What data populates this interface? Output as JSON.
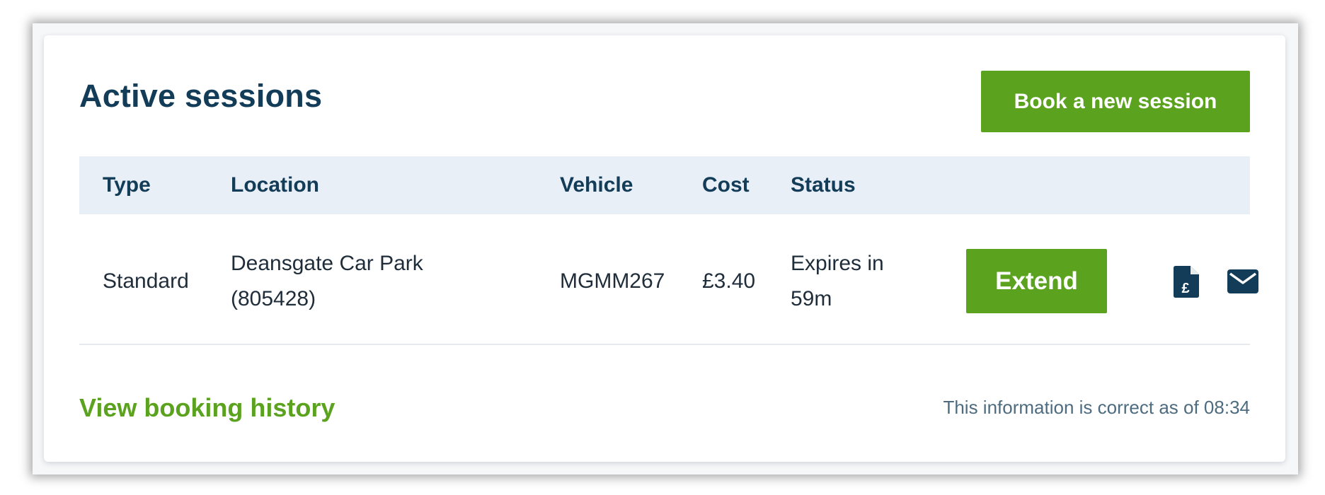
{
  "header": {
    "title": "Active sessions",
    "book_button": "Book a new session"
  },
  "table": {
    "columns": [
      "Type",
      "Location",
      "Vehicle",
      "Cost",
      "Status"
    ],
    "rows": [
      {
        "type": "Standard",
        "location_line1": "Deansgate Car Park",
        "location_line2": "(805428)",
        "vehicle": "MGMM267",
        "cost": "£3.40",
        "status_line1": "Expires in",
        "status_line2": "59m",
        "extend_label": "Extend",
        "actions": [
          "receipt-pound-icon",
          "email-icon"
        ]
      }
    ]
  },
  "footer": {
    "history_link": "View booking history",
    "updated_text": "This information is correct as of 08:34"
  },
  "colors": {
    "brand_green": "#5ba21f",
    "heading_navy": "#123c57",
    "header_bg": "#e9eff7"
  }
}
